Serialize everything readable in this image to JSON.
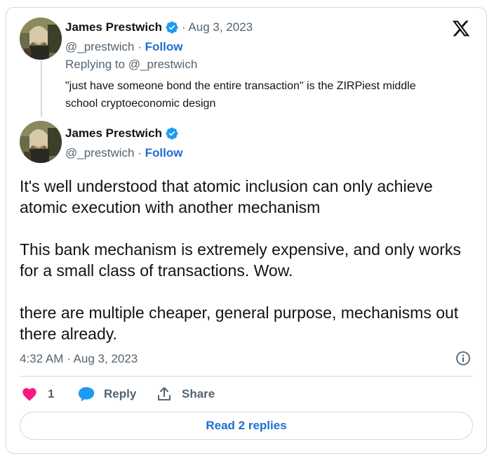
{
  "quoted_tweet": {
    "author_name": "James Prestwich",
    "date": "· Aug 3, 2023",
    "handle": "@_prestwich",
    "separator": " · ",
    "follow_label": "Follow",
    "replying_to": "Replying to @_prestwich",
    "text": "\"just have someone bond the entire transaction\" is the ZIRPiest middle school cryptoeconomic design"
  },
  "main_tweet": {
    "author_name": "James Prestwich",
    "handle": "@_prestwich",
    "separator": " · ",
    "follow_label": "Follow",
    "paragraphs": [
      "It's well understood that atomic inclusion can only achieve atomic execution with another mechanism",
      "This bank mechanism is extremely expensive, and only works for a small class of transactions. Wow.",
      "there are multiple cheaper, general purpose, mechanisms out there already."
    ],
    "timestamp": "4:32 AM · Aug 3, 2023"
  },
  "actions": {
    "like_count": "1",
    "reply_label": "Reply",
    "share_label": "Share"
  },
  "read_replies_label": "Read 2 replies",
  "icons": [
    "verified-badge-icon",
    "x-logo-icon",
    "info-icon",
    "heart-icon",
    "reply-bubble-icon",
    "share-icon"
  ],
  "colors": {
    "accent": "#1d6fd0",
    "verified": "#1d9bf0",
    "like": "#f91880",
    "secondary_text": "#536471",
    "border": "#cfd9de"
  }
}
